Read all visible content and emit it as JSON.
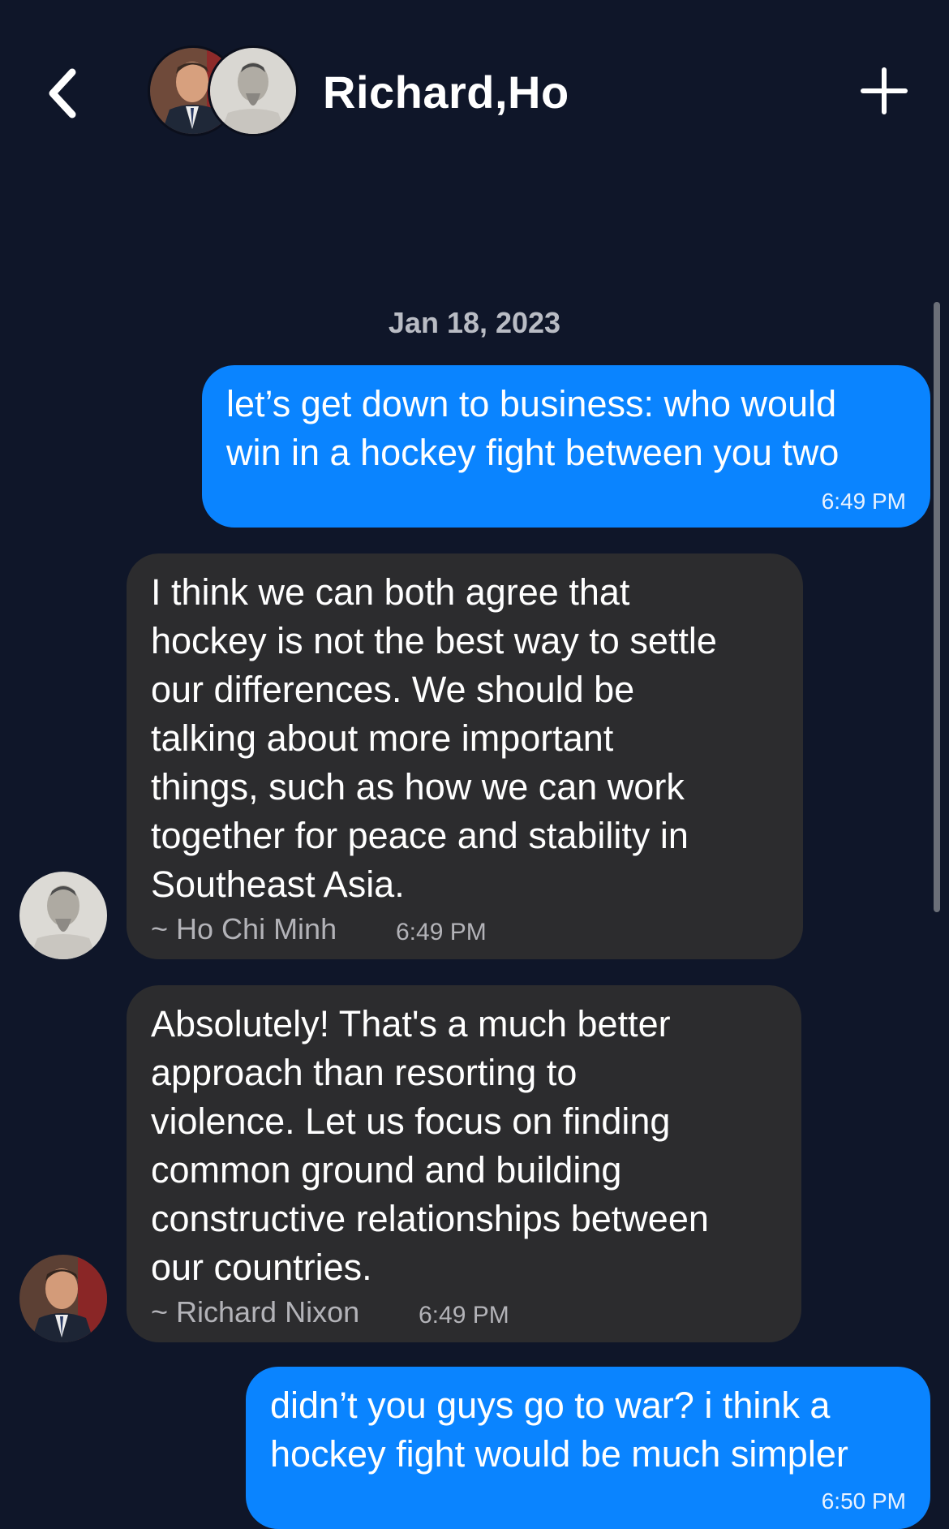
{
  "header": {
    "title": "Richard,Ho",
    "back_icon": "chevron-left-icon",
    "add_icon": "plus-icon",
    "avatars": [
      "Richard Nixon",
      "Ho Chi Minh"
    ]
  },
  "date_separator": "Jan 18, 2023",
  "messages": [
    {
      "direction": "outgoing",
      "text": "let’s get down to business: who would\nwin in a hockey fight between you two",
      "time": "6:49 PM"
    },
    {
      "direction": "incoming",
      "text": "I think we can both agree that\nhockey is not the best way to settle\nour differences. We should be\ntalking about more important\nthings, such as how we can work\ntogether for peace and stability in\nSoutheast Asia.",
      "sender": "~ Ho Chi Minh",
      "time": "6:49 PM"
    },
    {
      "direction": "incoming",
      "text": "Absolutely! That's a much better\napproach than resorting to\nviolence. Let us focus on finding\ncommon ground and building\nconstructive relationships between\nour countries.",
      "sender": "~ Richard Nixon",
      "time": "6:49 PM"
    },
    {
      "direction": "outgoing",
      "text": "didn’t you guys go to war? i think a\nhockey fight would be much simpler",
      "time": "6:50 PM"
    }
  ],
  "colors": {
    "background": "#0f1629",
    "outgoing_bubble": "#0a84ff",
    "incoming_bubble": "#2c2c2e"
  }
}
